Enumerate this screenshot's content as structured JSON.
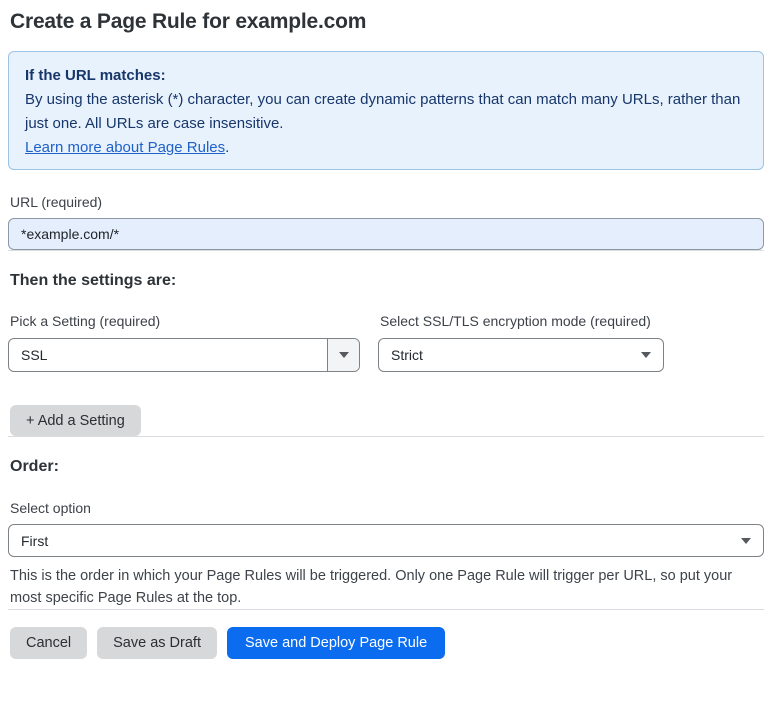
{
  "page": {
    "title": "Create a Page Rule for example.com"
  },
  "info_box": {
    "heading": "If the URL matches:",
    "body": "By using the asterisk (*) character, you can create dynamic patterns that can match many URLs, rather than just one. All URLs are case insensitive.",
    "link_label": "Learn more about Page Rules",
    "link_suffix": "."
  },
  "url_field": {
    "label": "URL (required)",
    "value": "*example.com/*"
  },
  "settings_section": {
    "heading": "Then the settings are:",
    "setting_picker": {
      "label": "Pick a Setting (required)",
      "value": "SSL"
    },
    "ssl_mode": {
      "label": "Select SSL/TLS encryption mode (required)",
      "value": "Strict"
    },
    "add_setting_label": "+ Add a Setting"
  },
  "order_section": {
    "heading": "Order:",
    "select_label": "Select option",
    "value": "First",
    "help_text": "This is the order in which your Page Rules will be triggered. Only one Page Rule will trigger per URL, so put your most specific Page Rules at the top."
  },
  "footer": {
    "cancel_label": "Cancel",
    "save_draft_label": "Save as Draft",
    "save_deploy_label": "Save and Deploy Page Rule"
  },
  "colors": {
    "accent_blue": "#0b6cf0",
    "info_background": "#e8f2fc",
    "info_border": "#9cc3e6",
    "info_text": "#17366b",
    "link_blue": "#2061c9",
    "input_background": "#e4eefc",
    "button_gray": "#d7d8d9"
  }
}
